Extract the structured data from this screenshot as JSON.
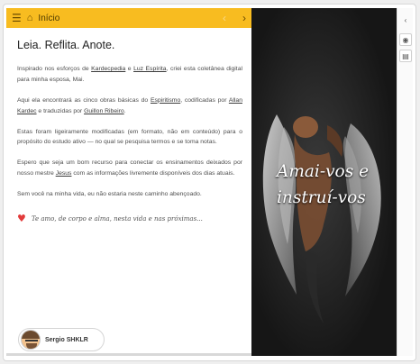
{
  "header": {
    "menu_icon": "hamburger-icon",
    "home_icon": "home-icon",
    "title": "Início",
    "prev_icon": "chevron-left-icon",
    "next_icon": "chevron-right-icon"
  },
  "page": {
    "title": "Leia. Reflita. Anote.",
    "paragraphs": {
      "p1": {
        "a": "Inspirado nos esforços de ",
        "link1": "Kardecpedia",
        "b": " e ",
        "link2": "Luz Espírita",
        "c": ", criei esta coletânea digital para minha esposa, Mai."
      },
      "p2": {
        "a": "Aqui ela encontrará as cinco obras básicas do ",
        "link1": "Espiritismo",
        "b": ", codificadas por ",
        "link2": "Allan Kardec",
        "c": " e traduzidas por ",
        "link3": "Guillon Ribeiro",
        "d": "."
      },
      "p3": "Estas foram ligeiramente modificadas (em formato, não em conteúdo) para o propósito do estudo ativo — no qual se pesquisa termos e se toma notas.",
      "p4": {
        "a": "Espero que seja um bom recurso para conectar os ensinamentos deixados por nosso mestre ",
        "link1": "Jesus",
        "b": " com as informações livremente disponíveis dos dias atuais."
      },
      "p5": "Sem você na minha vida, eu não estaria neste caminho abençoado."
    },
    "dedication": "Te amo, de corpo e alma, nesta vida e nas próximas..."
  },
  "author": {
    "name": "Sergio SHKLR"
  },
  "image": {
    "quote_line1": "Amai-vos e",
    "quote_line2": "instruí-vos"
  },
  "side_tools": {
    "collapse_icon": "chevron-left-icon",
    "view_icon": "eye-icon",
    "note_icon": "note-icon"
  },
  "colors": {
    "accent": "#f8bc20",
    "dark_panel": "#181818",
    "heart": "#e23b3b"
  }
}
